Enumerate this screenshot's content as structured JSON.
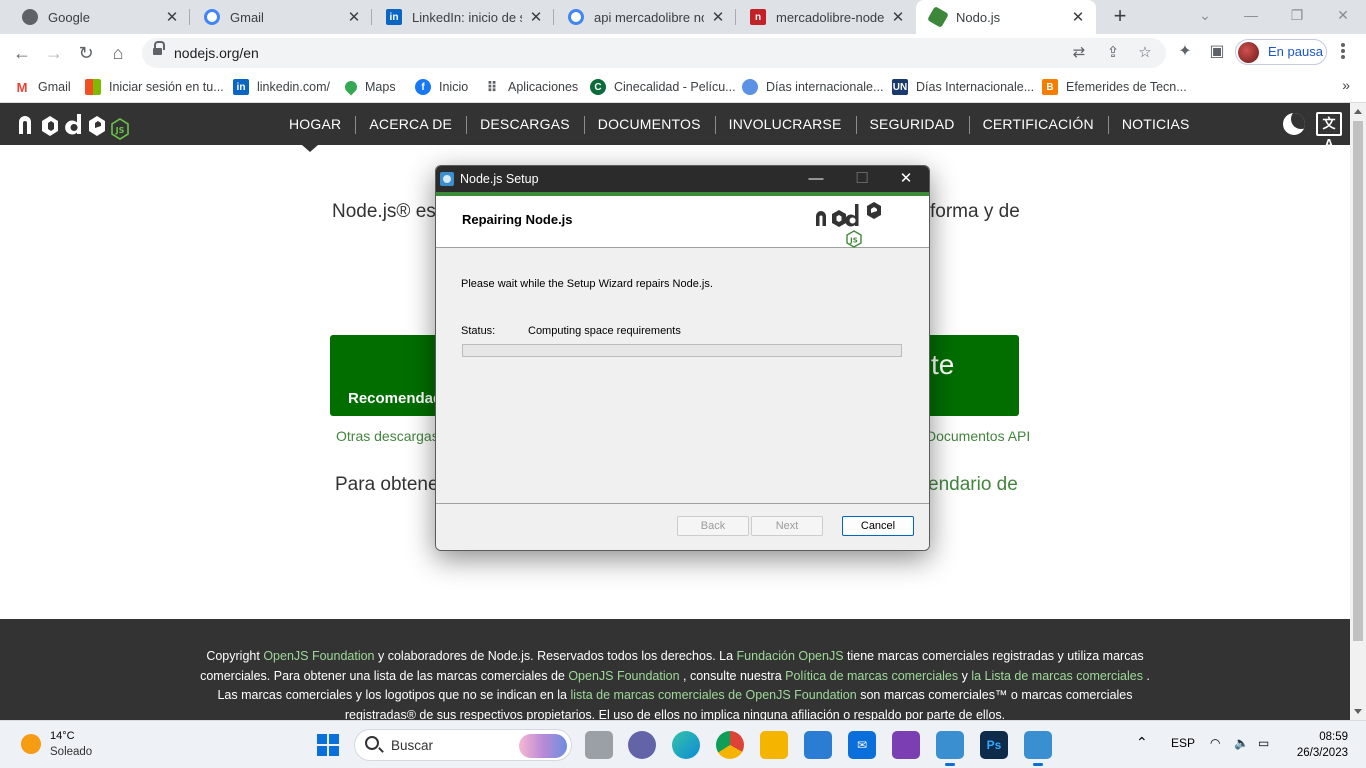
{
  "browser": {
    "tabs": [
      {
        "title": "Google",
        "icon": "chrome-icon",
        "color": "#5f6368"
      },
      {
        "title": "Gmail",
        "icon": "google-icon",
        "color": "#4285f4"
      },
      {
        "title": "LinkedIn: inicio de ses",
        "icon": "linkedin-icon",
        "color": "#0a66c2"
      },
      {
        "title": "api mercadolibre node",
        "icon": "google-icon",
        "color": "#4285f4"
      },
      {
        "title": "mercadolibre-nodejs-",
        "icon": "npm-icon",
        "color": "#c12127"
      },
      {
        "title": "Nodo.js",
        "icon": "nodejs-icon",
        "color": "#3c873a"
      }
    ],
    "url": "nodejs.org/en",
    "profile_label": "En pausa",
    "bookmarks": [
      {
        "label": "Gmail",
        "icon": "gmail-icon",
        "color": "#ea4335"
      },
      {
        "label": "Iniciar sesión en tu...",
        "icon": "microsoft-icon",
        "color": "#f25022"
      },
      {
        "label": "linkedin.com/",
        "icon": "linkedin-icon",
        "color": "#0a66c2"
      },
      {
        "label": "Maps",
        "icon": "maps-icon",
        "color": "#34a853"
      },
      {
        "label": "Inicio",
        "icon": "facebook-icon",
        "color": "#1877f2"
      },
      {
        "label": "Aplicaciones",
        "icon": "apps-grid-icon",
        "color": "#5f6368"
      },
      {
        "label": "Cinecalidad - Pelícu...",
        "icon": "cinecalidad-icon",
        "color": "#0b6b3a"
      },
      {
        "label": "Días internacionale...",
        "icon": "un-emblem-icon",
        "color": "#5b92e5"
      },
      {
        "label": "Días Internacionale...",
        "icon": "un-logo-icon",
        "color": "#1a3a6b"
      },
      {
        "label": "Efemerides de Tecn...",
        "icon": "blogger-icon",
        "color": "#f57d00"
      }
    ]
  },
  "site": {
    "nav": [
      "HOGAR",
      "ACERCA DE",
      "DESCARGAS",
      "DOCUMENTOS",
      "INVOLUCRARSE",
      "SEGURIDAD",
      "CERTIFICACIÓN",
      "NOTICIAS"
    ],
    "hero_left": "Node.js® es u",
    "hero_right": "forma y de",
    "green_left_label": "Recomendad",
    "green_right_fragment": "te",
    "links_left": "Otras descargas |",
    "links_right": "Documentos API",
    "para_left": "Para obtene",
    "para_right": "endario de",
    "footer": {
      "t1": "Copyright ",
      "l1": "OpenJS Foundation",
      "t2": " y colaboradores de Node.js. Reservados todos los derechos. La ",
      "l2": "Fundación OpenJS",
      "t3": " tiene marcas comerciales registradas y utiliza marcas comerciales. Para obtener una lista de las marcas comerciales de ",
      "l3": "OpenJS Foundation",
      "t4": " , consulte nuestra ",
      "l4": "Política de marcas comerciales",
      "t5": " y ",
      "l5": "la Lista de marcas comerciales",
      "t6": " . Las marcas comerciales y los logotipos que no se indican en la ",
      "l6": "lista de marcas comerciales de OpenJS Foundation",
      "t7": " son marcas comerciales™ o marcas comerciales registradas® de sus respectivos propietarios. El uso de ellos no implica ninguna afiliación o respaldo por parte de ellos."
    }
  },
  "dialog": {
    "title": "Node.js Setup",
    "heading": "Repairing Node.js",
    "message": "Please wait while the Setup Wizard repairs Node.js.",
    "status_label": "Status:",
    "status_value": "Computing space requirements",
    "progress": 0,
    "back": "Back",
    "next": "Next",
    "cancel": "Cancel"
  },
  "taskbar": {
    "temperature": "14°C",
    "weather": "Soleado",
    "search": "Buscar",
    "language": "ESP",
    "time": "08:59",
    "date": "26/3/2023",
    "apps": [
      {
        "name": "task-view-icon",
        "color": "#5b5b5b"
      },
      {
        "name": "teams-chat-icon",
        "color": "#6264a7"
      },
      {
        "name": "edge-icon",
        "color": "#0c8bd6"
      },
      {
        "name": "chrome-icon",
        "color": "#db4437"
      },
      {
        "name": "file-explorer-icon",
        "color": "#f5b400"
      },
      {
        "name": "microsoft-store-icon",
        "color": "#2b7cd3"
      },
      {
        "name": "mail-icon",
        "color": "#0a6fdb"
      },
      {
        "name": "visual-studio-icon",
        "color": "#7b3fb3"
      },
      {
        "name": "installer-icon",
        "color": "#3a8fd0"
      },
      {
        "name": "photoshop-icon",
        "color": "#0f2b4a"
      },
      {
        "name": "setup-icon",
        "color": "#3a8fd0"
      }
    ]
  },
  "colors": {
    "node_green": "#026e00",
    "nav_dark": "#333333",
    "dialog_accent": "#3c8b3a"
  }
}
